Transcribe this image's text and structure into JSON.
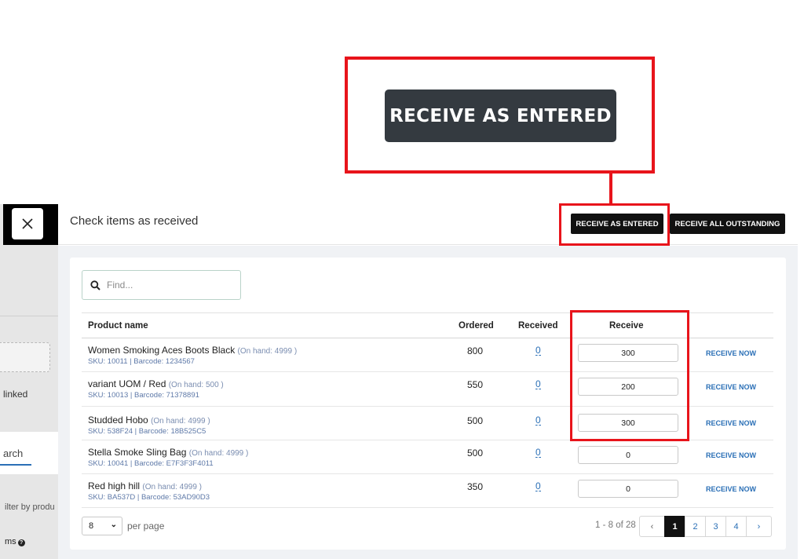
{
  "callout": {
    "label": "RECEIVE AS ENTERED"
  },
  "modal": {
    "title": "Check items as received",
    "btn_receive_entered": "RECEIVE AS ENTERED",
    "btn_receive_all": "RECEIVE ALL OUTSTANDING"
  },
  "left_panel": {
    "linked": "linked",
    "search_tab": "arch",
    "filter_text": "ilter by produ",
    "items_text": "ms"
  },
  "search": {
    "placeholder": "Find..."
  },
  "table": {
    "headers": {
      "product": "Product name",
      "ordered": "Ordered",
      "received": "Received",
      "receive": "Receive"
    },
    "rows": [
      {
        "name": "Women Smoking Aces Boots Black",
        "onhand": "(On hand: 4999 )",
        "sku": "SKU: 10011 | Barcode: 1234567",
        "ordered": "800",
        "received": "0",
        "receive": "300",
        "action": "RECEIVE NOW"
      },
      {
        "name": "variant UOM / Red",
        "onhand": "(On hand: 500 )",
        "sku": "SKU: 10013 | Barcode: 71378891",
        "ordered": "550",
        "received": "0",
        "receive": "200",
        "action": "RECEIVE NOW"
      },
      {
        "name": "Studded Hobo",
        "onhand": "(On hand: 4999 )",
        "sku": "SKU: 538F24 | Barcode: 18B525C5",
        "ordered": "500",
        "received": "0",
        "receive": "300",
        "action": "RECEIVE NOW"
      },
      {
        "name": "Stella Smoke Sling Bag",
        "onhand": "(On hand: 4999 )",
        "sku": "SKU: 10041 | Barcode: E7F3F3F4011",
        "ordered": "500",
        "received": "0",
        "receive": "0",
        "action": "RECEIVE NOW"
      },
      {
        "name": "Red high hill",
        "onhand": "(On hand: 4999 )",
        "sku": "SKU: BA537D | Barcode: 53AD90D3",
        "ordered": "350",
        "received": "0",
        "receive": "0",
        "action": "RECEIVE NOW"
      }
    ]
  },
  "pagination": {
    "per_page_value": "8",
    "per_page_label": "per page",
    "range": "1 - 8 of 28",
    "prev": "‹",
    "pages": [
      "1",
      "2",
      "3",
      "4"
    ],
    "next": "›",
    "active_page": "1"
  },
  "colors": {
    "highlight": "#e8141b",
    "link": "#2a6fb6",
    "dark_button": "#111111",
    "callout_button": "#343a40"
  },
  "icons": {
    "close": "close-icon",
    "search": "search-icon",
    "chevron": "chevron-down-icon",
    "help": "help-icon"
  }
}
